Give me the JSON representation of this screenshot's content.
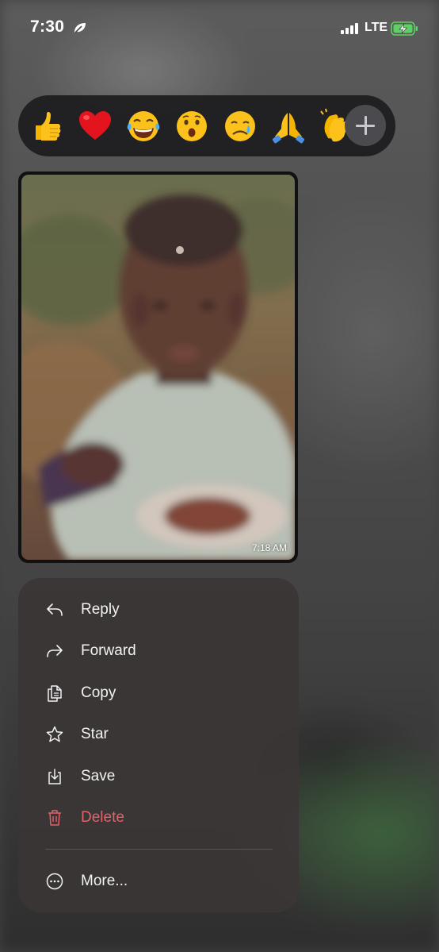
{
  "status_bar": {
    "time": "7:30",
    "network": "LTE"
  },
  "reactions": {
    "emojis": [
      "thumbs-up",
      "red-heart",
      "tears-of-joy",
      "surprised",
      "crying",
      "folded-hands",
      "clapping-hands"
    ],
    "add_icon": "plus-icon"
  },
  "message": {
    "timestamp": "7:18 AM"
  },
  "menu": {
    "items": [
      {
        "label": "Reply",
        "icon": "reply-icon"
      },
      {
        "label": "Forward",
        "icon": "forward-icon"
      },
      {
        "label": "Copy",
        "icon": "copy-icon"
      },
      {
        "label": "Star",
        "icon": "star-icon"
      },
      {
        "label": "Save",
        "icon": "save-icon"
      },
      {
        "label": "Delete",
        "icon": "trash-icon"
      },
      {
        "label": "More...",
        "icon": "more-icon"
      }
    ],
    "delete_color": "#e2626b"
  }
}
